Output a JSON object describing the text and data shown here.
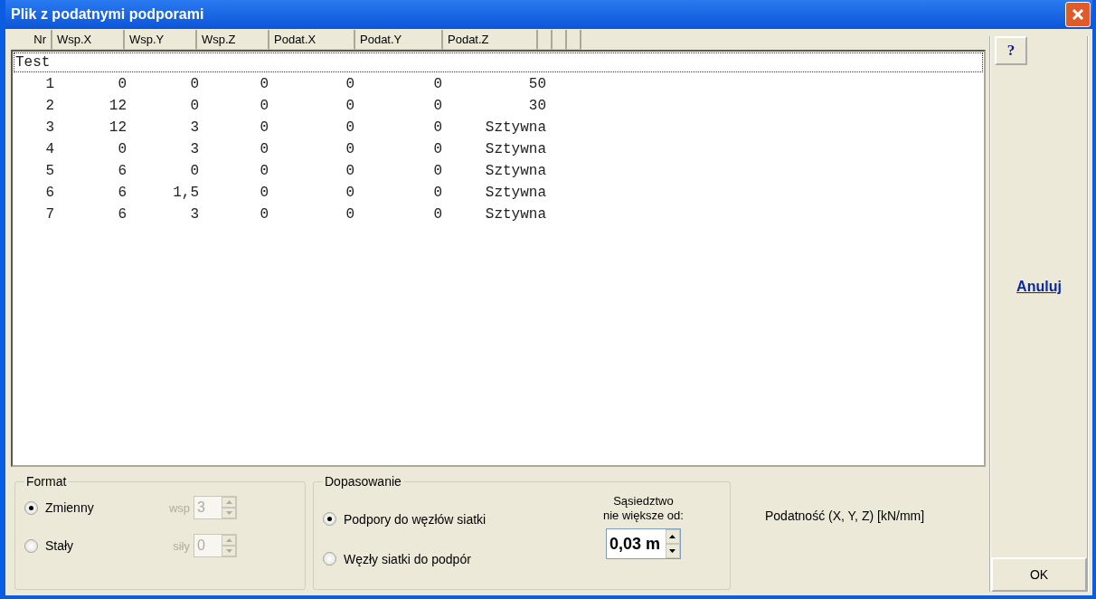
{
  "window": {
    "title": "Plik z podatnymi podporami"
  },
  "table": {
    "columns": [
      "Nr",
      "Wsp.X",
      "Wsp.Y",
      "Wsp.Z",
      "Podat.X",
      "Podat.Y",
      "Podat.Z"
    ],
    "title_line": "Test",
    "rows": [
      [
        "1",
        "0",
        "0",
        "0",
        "0",
        "0",
        "50"
      ],
      [
        "2",
        "12",
        "0",
        "0",
        "0",
        "0",
        "30"
      ],
      [
        "3",
        "12",
        "3",
        "0",
        "0",
        "0",
        "Sztywna"
      ],
      [
        "4",
        "0",
        "3",
        "0",
        "0",
        "0",
        "Sztywna"
      ],
      [
        "5",
        "6",
        "0",
        "0",
        "0",
        "0",
        "Sztywna"
      ],
      [
        "6",
        "6",
        "1,5",
        "0",
        "0",
        "0",
        "Sztywna"
      ],
      [
        "7",
        "6",
        "3",
        "0",
        "0",
        "0",
        "Sztywna"
      ]
    ]
  },
  "format": {
    "title": "Format",
    "options": [
      {
        "label": "Zmienny",
        "selected": true,
        "spin_label": "wsp",
        "spin_value": "3",
        "disabled": true
      },
      {
        "label": "Stały",
        "selected": false,
        "spin_label": "siły",
        "spin_value": "0",
        "disabled": true
      }
    ]
  },
  "matching": {
    "title": "Dopasowanie",
    "options": [
      {
        "label": "Podpory do węzłów siatki",
        "selected": true
      },
      {
        "label": "Węzły siatki do podpór",
        "selected": false
      }
    ],
    "neighborhood_label": [
      "Sąsiedztwo",
      "nie większe od:"
    ],
    "neighborhood_value": "0,03 m"
  },
  "compliance_label": "Podatność (X, Y, Z) [kN/mm]",
  "buttons": {
    "help": "?",
    "cancel": "Anuluj",
    "ok": "OK"
  }
}
